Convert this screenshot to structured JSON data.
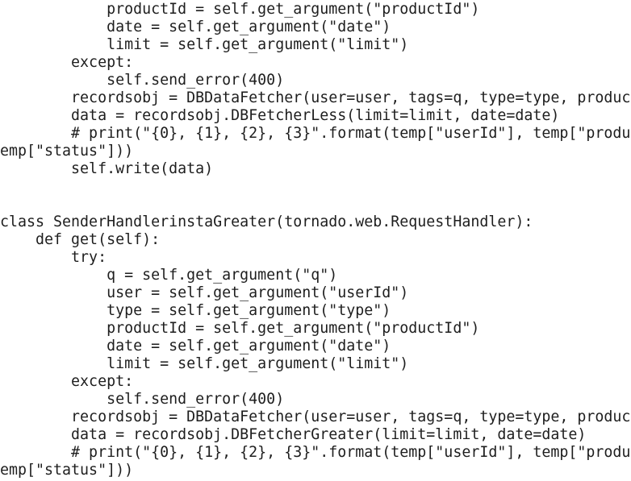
{
  "editor": {
    "lines": [
      "            productId = self.get_argument(\"productId\")",
      "            date = self.get_argument(\"date\")",
      "            limit = self.get_argument(\"limit\")",
      "        except:",
      "            self.send_error(400)",
      "        recordsobj = DBDataFetcher(user=user, tags=q, type=type, produc",
      "        data = recordsobj.DBFetcherLess(limit=limit, date=date)",
      "        # print(\"{0}, {1}, {2}, {3}\".format(temp[\"userId\"], temp[\"produ",
      "emp[\"status\"]))",
      "        self.write(data)",
      "",
      "",
      "class SenderHandlerinstaGreater(tornado.web.RequestHandler):",
      "    def get(self):",
      "        try:",
      "            q = self.get_argument(\"q\")",
      "            user = self.get_argument(\"userId\")",
      "            type = self.get_argument(\"type\")",
      "            productId = self.get_argument(\"productId\")",
      "            date = self.get_argument(\"date\")",
      "            limit = self.get_argument(\"limit\")",
      "        except:",
      "            self.send_error(400)",
      "        recordsobj = DBDataFetcher(user=user, tags=q, type=type, produc",
      "        data = recordsobj.DBFetcherGreater(limit=limit, date=date)",
      "        # print(\"{0}, {1}, {2}, {3}\".format(temp[\"userId\"], temp[\"produ",
      "emp[\"status\"]))"
    ]
  }
}
